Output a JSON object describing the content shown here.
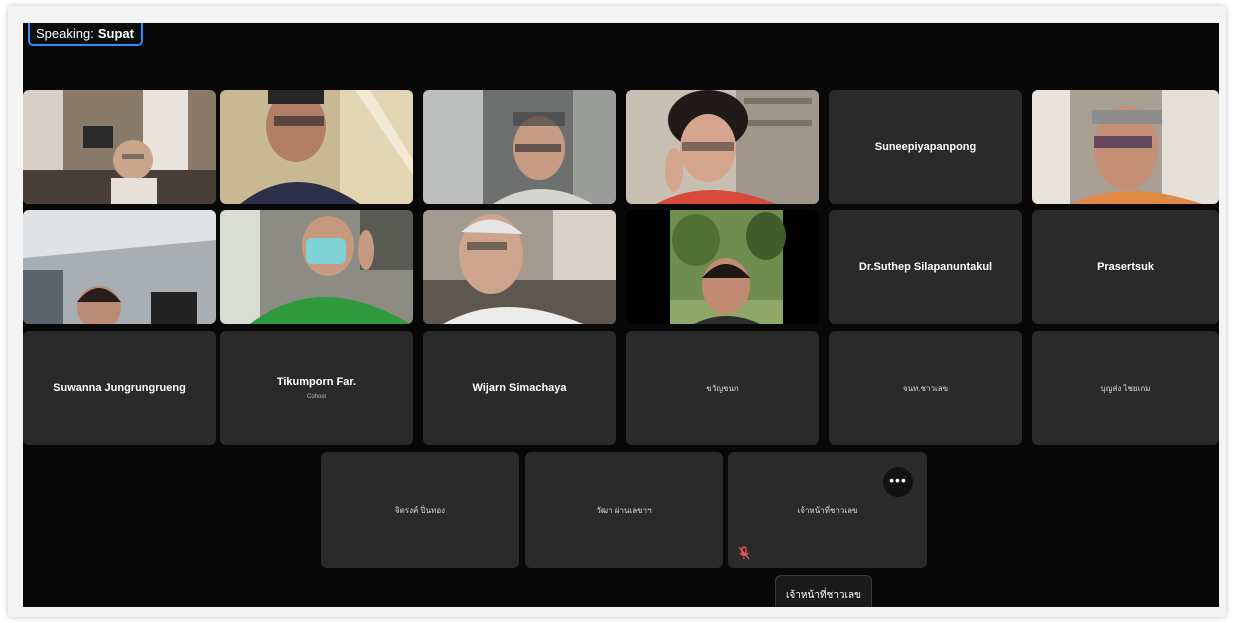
{
  "speaking": {
    "prefix": "Speaking:",
    "name": "Supat"
  },
  "tiles": [
    {
      "kind": "video"
    },
    {
      "kind": "video"
    },
    {
      "kind": "video"
    },
    {
      "kind": "video"
    },
    {
      "kind": "name",
      "name": "Suneepiyapanpong"
    },
    {
      "kind": "video"
    },
    {
      "kind": "video"
    },
    {
      "kind": "video"
    },
    {
      "kind": "video"
    },
    {
      "kind": "video"
    },
    {
      "kind": "name",
      "name": "Dr.Suthep Silapanuntakul"
    },
    {
      "kind": "name",
      "name": "Prasertsuk"
    },
    {
      "kind": "name",
      "name": "Suwanna Jungrungrueng"
    },
    {
      "kind": "name",
      "name": "Tikumporn Far.",
      "role": "Cohost"
    },
    {
      "kind": "name",
      "name": "Wijarn Simachaya"
    },
    {
      "kind": "name",
      "name": "ขวัญชนก"
    },
    {
      "kind": "name",
      "name": "จนท.ชาวเลข"
    },
    {
      "kind": "name",
      "name": "บุญส่ง ไชยเกม"
    },
    {
      "kind": "name",
      "name": "จิตรงค์ ปิ่นทอง"
    },
    {
      "kind": "name",
      "name": "วัฒา ผ่านเลขาฯ"
    },
    {
      "kind": "name",
      "name": "เจ้าหน้าที่ชาวเลข",
      "more": "•••"
    }
  ],
  "tooltip": "เจ้าหน้าที่ชาวเลข",
  "colors": {
    "accent": "#2d8cff",
    "tile_bg": "#2a2a2a",
    "stage_bg": "#080808",
    "muted": "#ff5a5a"
  },
  "icons": {
    "more": "ellipsis-icon",
    "mic": "mic-muted-icon"
  }
}
